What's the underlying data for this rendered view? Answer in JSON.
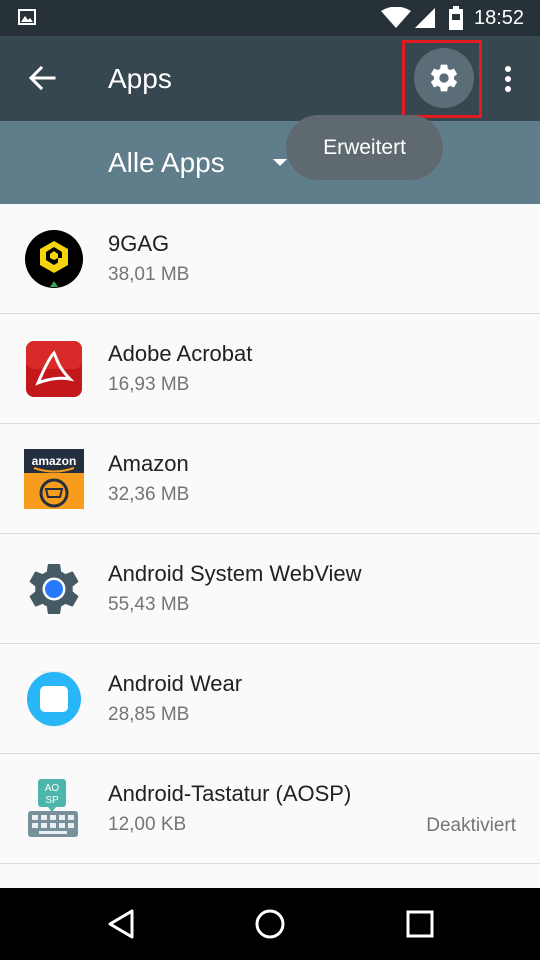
{
  "status_bar": {
    "time": "18:52"
  },
  "toolbar": {
    "title": "Apps"
  },
  "filter": {
    "selected": "Alle Apps"
  },
  "tooltip": {
    "text": "Erweitert"
  },
  "apps": [
    {
      "name": "9GAG",
      "size": "38,01 MB",
      "status": "",
      "icon": "9gag-icon"
    },
    {
      "name": "Adobe Acrobat",
      "size": "16,93 MB",
      "status": "",
      "icon": "adobe-acrobat-icon"
    },
    {
      "name": "Amazon",
      "size": "32,36 MB",
      "status": "",
      "icon": "amazon-icon"
    },
    {
      "name": "Android System WebView",
      "size": "55,43 MB",
      "status": "",
      "icon": "webview-icon"
    },
    {
      "name": "Android Wear",
      "size": "28,85 MB",
      "status": "",
      "icon": "android-wear-icon"
    },
    {
      "name": "Android-Tastatur (AOSP)",
      "size": "12,00 KB",
      "status": "Deaktiviert",
      "icon": "keyboard-icon"
    }
  ],
  "colors": {
    "status_bar": "#263238",
    "toolbar": "#37474f",
    "filter_bar": "#607d8b",
    "highlight": "#e31b23"
  }
}
